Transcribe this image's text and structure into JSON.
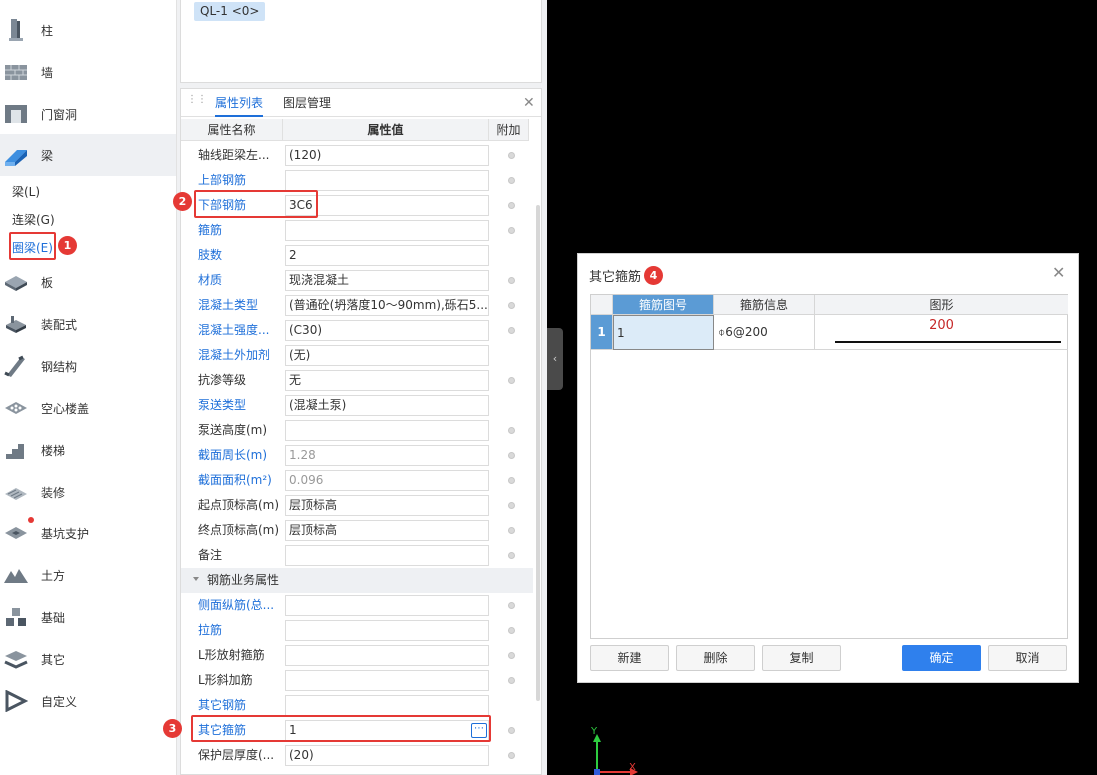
{
  "sidebar": {
    "items": [
      {
        "label": "柱",
        "icon": "column-icon"
      },
      {
        "label": "墙",
        "icon": "wall-icon"
      },
      {
        "label": "门窗洞",
        "icon": "door-window-icon"
      },
      {
        "label": "梁",
        "icon": "beam-icon"
      },
      {
        "label": "板",
        "icon": "slab-icon"
      },
      {
        "label": "装配式",
        "icon": "prefab-icon"
      },
      {
        "label": "钢结构",
        "icon": "steel-structure-icon"
      },
      {
        "label": "空心楼盖",
        "icon": "hollow-floor-icon"
      },
      {
        "label": "楼梯",
        "icon": "stair-icon"
      },
      {
        "label": "装修",
        "icon": "decoration-icon"
      },
      {
        "label": "基坑支护",
        "icon": "pit-support-icon"
      },
      {
        "label": "土方",
        "icon": "earthwork-icon"
      },
      {
        "label": "基础",
        "icon": "foundation-icon"
      },
      {
        "label": "其它",
        "icon": "other-icon"
      },
      {
        "label": "自定义",
        "icon": "custom-icon"
      }
    ],
    "beam_sub": [
      "梁(L)",
      "连梁(G)",
      "圈梁(E)"
    ]
  },
  "component_tag": "QL-1 <0>",
  "props": {
    "tabs": [
      "属性列表",
      "图层管理"
    ],
    "headers": [
      "属性名称",
      "属性值",
      "附加"
    ],
    "rows": [
      {
        "name": "轴线距梁左...",
        "value": "(120)"
      },
      {
        "name": "上部钢筋",
        "value": ""
      },
      {
        "name": "下部钢筋",
        "value": "3C6"
      },
      {
        "name": "箍筋",
        "value": ""
      },
      {
        "name": "肢数",
        "value": "2"
      },
      {
        "name": "材质",
        "value": "现浇混凝土"
      },
      {
        "name": "混凝土类型",
        "value": "(普通砼(坍落度10～90mm),砾石5..."
      },
      {
        "name": "混凝土强度...",
        "value": "(C30)"
      },
      {
        "name": "混凝土外加剂",
        "value": "(无)"
      },
      {
        "name": "抗渗等级",
        "value": "无"
      },
      {
        "name": "泵送类型",
        "value": "(混凝土泵)"
      },
      {
        "name": "泵送高度(m)",
        "value": ""
      },
      {
        "name": "截面周长(m)",
        "value": "1.28"
      },
      {
        "name": "截面面积(m²)",
        "value": "0.096"
      },
      {
        "name": "起点顶标高(m)",
        "value": "层顶标高"
      },
      {
        "name": "终点顶标高(m)",
        "value": "层顶标高"
      },
      {
        "name": "备注",
        "value": ""
      }
    ],
    "group": "钢筋业务属性",
    "group_rows": [
      {
        "name": "侧面纵筋(总...",
        "value": ""
      },
      {
        "name": "拉筋",
        "value": ""
      },
      {
        "name": "L形放射箍筋",
        "value": ""
      },
      {
        "name": "L形斜加筋",
        "value": ""
      },
      {
        "name": "其它钢筋",
        "value": ""
      },
      {
        "name": "其它箍筋",
        "value": "1"
      },
      {
        "name": "保护层厚度(...",
        "value": "(20)"
      }
    ],
    "more_button": "⋯"
  },
  "badges": [
    "1",
    "2",
    "3",
    "4"
  ],
  "dialog": {
    "title": "其它箍筋",
    "columns": [
      "箍筋图号",
      "箍筋信息",
      "图形"
    ],
    "rows": [
      {
        "index": "1",
        "number": "1",
        "info": "⌽6@200",
        "shape_value": "200"
      }
    ],
    "buttons": {
      "new": "新建",
      "delete": "删除",
      "copy": "复制",
      "ok": "确定",
      "cancel": "取消"
    }
  },
  "axis": {
    "y": "Y",
    "x": "X"
  },
  "colors": {
    "accent": "#1e6fd9",
    "highlight": "#e53935",
    "primary_button": "#2f80ed"
  }
}
